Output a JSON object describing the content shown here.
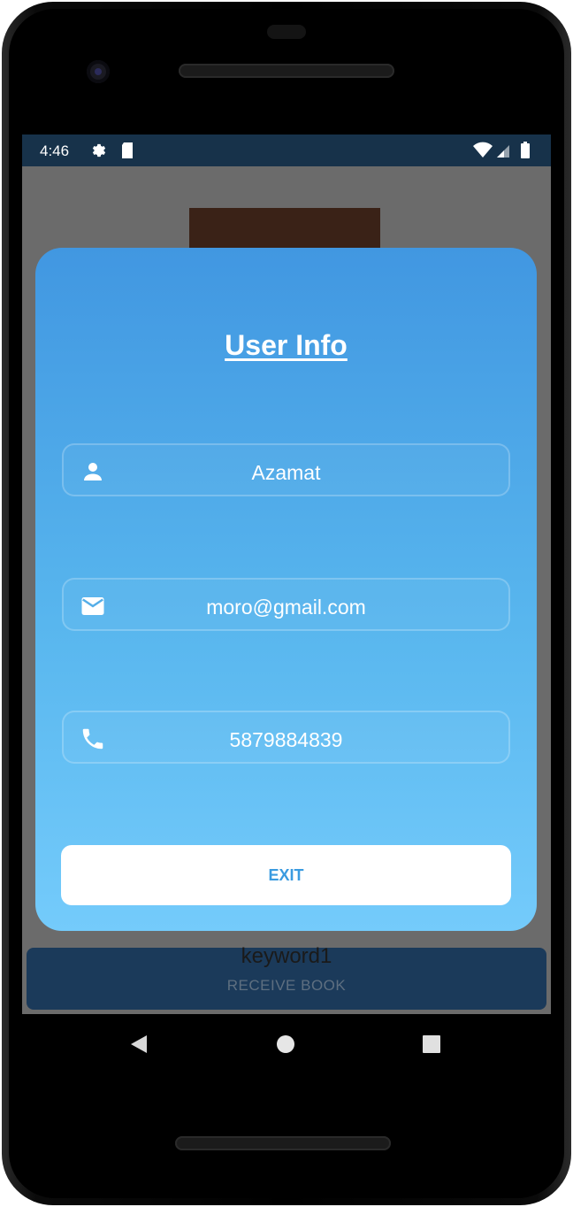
{
  "status_bar": {
    "time": "4:46",
    "icons": [
      "gear-icon",
      "sd-card-icon",
      "wifi-icon",
      "signal-icon",
      "battery-icon"
    ]
  },
  "dialog": {
    "title": "User Info",
    "fields": [
      {
        "icon": "person-icon",
        "value": "Azamat"
      },
      {
        "icon": "email-icon",
        "value": "moro@gmail.com"
      },
      {
        "icon": "phone-icon",
        "value": "5879884839"
      }
    ],
    "exit_label": "EXIT"
  },
  "background": {
    "keyword": "keyword1",
    "receive_button_label": "RECEIVE BOOK"
  },
  "nav_bar": {
    "icons": [
      "back-icon",
      "home-icon",
      "recents-icon"
    ]
  },
  "colors": {
    "dialog_gradient_top": "#4197e1",
    "dialog_gradient_bottom": "#74cbfb",
    "status_bar": "#17324a",
    "exit_text": "#3a9be0",
    "receive_button": "#1b3a5a"
  }
}
